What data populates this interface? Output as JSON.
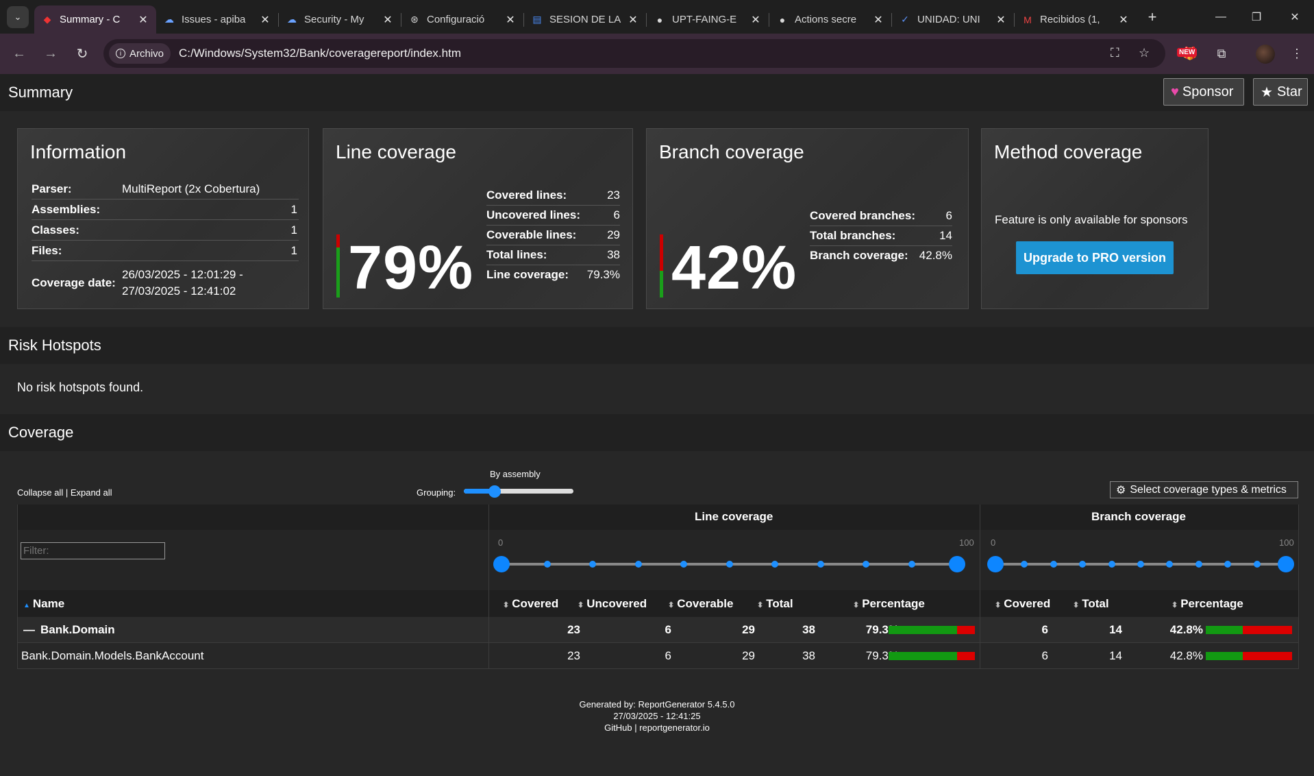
{
  "browser": {
    "tabs": [
      {
        "label": "Summary - C",
        "icon": "reportgenerator-icon",
        "active": true
      },
      {
        "label": "Issues - apiba",
        "icon": "azure-devops-icon"
      },
      {
        "label": "Security - My",
        "icon": "azure-devops-icon"
      },
      {
        "label": "Configuració",
        "icon": "openai-icon"
      },
      {
        "label": "SESION DE LA",
        "icon": "google-docs-icon"
      },
      {
        "label": "UPT-FAING-E",
        "icon": "github-icon"
      },
      {
        "label": "Actions secre",
        "icon": "github-icon"
      },
      {
        "label": "UNIDAD: UNI",
        "icon": "checkmark-icon"
      },
      {
        "label": "Recibidos (1,",
        "icon": "gmail-icon"
      }
    ],
    "chip_label": "Archivo",
    "url": "C:/Windows/System32/Bank/coveragereport/index.htm",
    "new_badge": "NEW"
  },
  "page": {
    "summary_title": "Summary",
    "sponsor_label": "Sponsor",
    "star_label": "Star",
    "info": {
      "title": "Information",
      "parser_k": "Parser:",
      "parser_v": "MultiReport (2x Cobertura)",
      "assemblies_k": "Assemblies:",
      "assemblies_v": "1",
      "classes_k": "Classes:",
      "classes_v": "1",
      "files_k": "Files:",
      "files_v": "1",
      "date_k": "Coverage date:",
      "date_v1": "26/03/2025 - 12:01:29 -",
      "date_v2": "27/03/2025 - 12:41:02"
    },
    "line": {
      "title": "Line coverage",
      "pct": "79%",
      "covered_k": "Covered lines:",
      "covered_v": "23",
      "uncovered_k": "Uncovered lines:",
      "uncovered_v": "6",
      "coverable_k": "Coverable lines:",
      "coverable_v": "29",
      "total_k": "Total lines:",
      "total_v": "38",
      "cov_k": "Line coverage:",
      "cov_v": "79.3%",
      "fraction": 0.793
    },
    "branch": {
      "title": "Branch coverage",
      "pct": "42%",
      "covered_k": "Covered branches:",
      "covered_v": "6",
      "total_k": "Total branches:",
      "total_v": "14",
      "cov_k": "Branch coverage:",
      "cov_v": "42.8%",
      "fraction": 0.428
    },
    "method": {
      "title": "Method coverage",
      "note": "Feature is only available for sponsors",
      "pro_label": "Upgrade to PRO version"
    },
    "risk_title": "Risk Hotspots",
    "risk_note": "No risk hotspots found.",
    "coverage_title": "Coverage",
    "collapse_all": "Collapse all",
    "expand_all": "Expand all",
    "grouping_label": "Grouping:",
    "grouping_value": "By assembly",
    "select_metrics": "Select coverage types & metrics",
    "table": {
      "line_header": "Line coverage",
      "branch_header": "Branch coverage",
      "filter_placeholder": "Filter:",
      "slider_min": "0",
      "slider_max": "100",
      "col_name": "Name",
      "col_covered": "Covered",
      "col_uncovered": "Uncovered",
      "col_coverable": "Coverable",
      "col_total": "Total",
      "col_percentage": "Percentage",
      "bcol_covered": "Covered",
      "bcol_total": "Total",
      "bcol_percentage": "Percentage",
      "rows": [
        {
          "name": "Bank.Domain",
          "covered": "23",
          "uncovered": "6",
          "coverable": "29",
          "total": "38",
          "pct": "79.3%",
          "bcovered": "6",
          "btotal": "14",
          "bpct": "42.8%"
        },
        {
          "name": "Bank.Domain.Models.BankAccount",
          "covered": "23",
          "uncovered": "6",
          "coverable": "29",
          "total": "38",
          "pct": "79.3%",
          "bcovered": "6",
          "btotal": "14",
          "bpct": "42.8%"
        }
      ]
    },
    "footer": {
      "line1": "Generated by: ReportGenerator 5.4.5.0",
      "line2": "27/03/2025 - 12:41:25",
      "line3": "GitHub | reportgenerator.io"
    }
  }
}
